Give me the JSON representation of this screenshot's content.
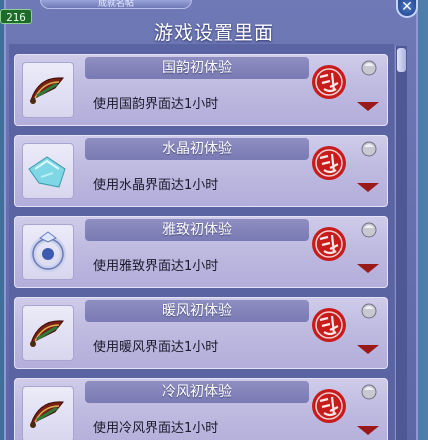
{
  "window": {
    "tab_label": "成就名帖",
    "title": "游戏设置里面",
    "close_symbol": "✕"
  },
  "player": {
    "level": "216"
  },
  "achievements": [
    {
      "title": "国韵初体验",
      "desc": "使用国韵界面达1小时",
      "status": "完成",
      "icon": "fan-icon"
    },
    {
      "title": "水晶初体验",
      "desc": "使用水晶界面达1小时",
      "status": "完成",
      "icon": "crystal-shard-icon"
    },
    {
      "title": "雅致初体验",
      "desc": "使用雅致界面达1小时",
      "status": "完成",
      "icon": "silver-ring-icon"
    },
    {
      "title": "暖风初体验",
      "desc": "使用暖风界面达1小时",
      "status": "完成",
      "icon": "fan-icon"
    },
    {
      "title": "冷风初体验",
      "desc": "使用冷风界面达1小时",
      "status": "完成",
      "icon": "fan-icon"
    }
  ],
  "colors": {
    "seal_red": "#c81c1c",
    "arrow_red": "#9a1a1a",
    "frame_purple": "#6f79b6"
  }
}
